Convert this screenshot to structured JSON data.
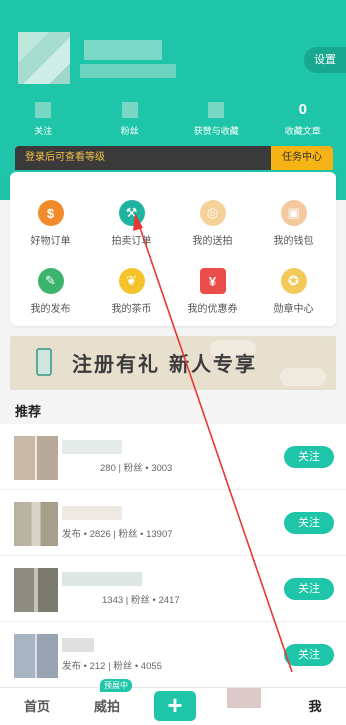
{
  "header": {
    "settings_label": "设置",
    "stats": [
      {
        "label": "关注",
        "value": ""
      },
      {
        "label": "粉丝",
        "value": ""
      },
      {
        "label": "获赞与收藏",
        "value": ""
      },
      {
        "label": "收藏文章",
        "value": "0"
      }
    ],
    "level_text": "登录后可查看等级",
    "task_center_label": "任务中心"
  },
  "grid": [
    {
      "label": "好物订单",
      "icon": "dollar-icon",
      "color": "#f28c2a",
      "glyph": "$"
    },
    {
      "label": "拍卖订单",
      "icon": "gavel-icon",
      "color": "#1fb3a0",
      "glyph": "⚒"
    },
    {
      "label": "我的送拍",
      "icon": "send-auction-icon",
      "color": "#f5d29a",
      "glyph": "◎"
    },
    {
      "label": "我的钱包",
      "icon": "wallet-icon",
      "color": "#f5c9a0",
      "glyph": "▣"
    },
    {
      "label": "我的发布",
      "icon": "pen-icon",
      "color": "#3db46d",
      "glyph": "✎"
    },
    {
      "label": "我的茶币",
      "icon": "leaf-coin-icon",
      "color": "#f3c329",
      "glyph": "❦"
    },
    {
      "label": "我的优惠券",
      "icon": "coupon-icon",
      "color": "#ea4e48",
      "glyph": "¥"
    },
    {
      "label": "勋章中心",
      "icon": "medal-icon",
      "color": "#f3c95a",
      "glyph": "✪"
    }
  ],
  "banner": {
    "text": "注册有礼  新人专享"
  },
  "recommend": {
    "title": "推荐",
    "follow_label": "关注",
    "items": [
      {
        "meta": "280 | 粉丝 • 3003"
      },
      {
        "meta": "发布 • 2826 | 粉丝 • 13907"
      },
      {
        "meta": "1343 | 粉丝 • 2417"
      },
      {
        "meta": "发布 • 212 | 粉丝 • 4055"
      }
    ]
  },
  "tabbar": {
    "home": "首页",
    "auction": "威拍",
    "auction_badge": "预展中",
    "plus": "+",
    "me": "我"
  },
  "colors": {
    "accent": "#1fc5a8",
    "task": "#f6b316",
    "arrow": "#e53935"
  }
}
